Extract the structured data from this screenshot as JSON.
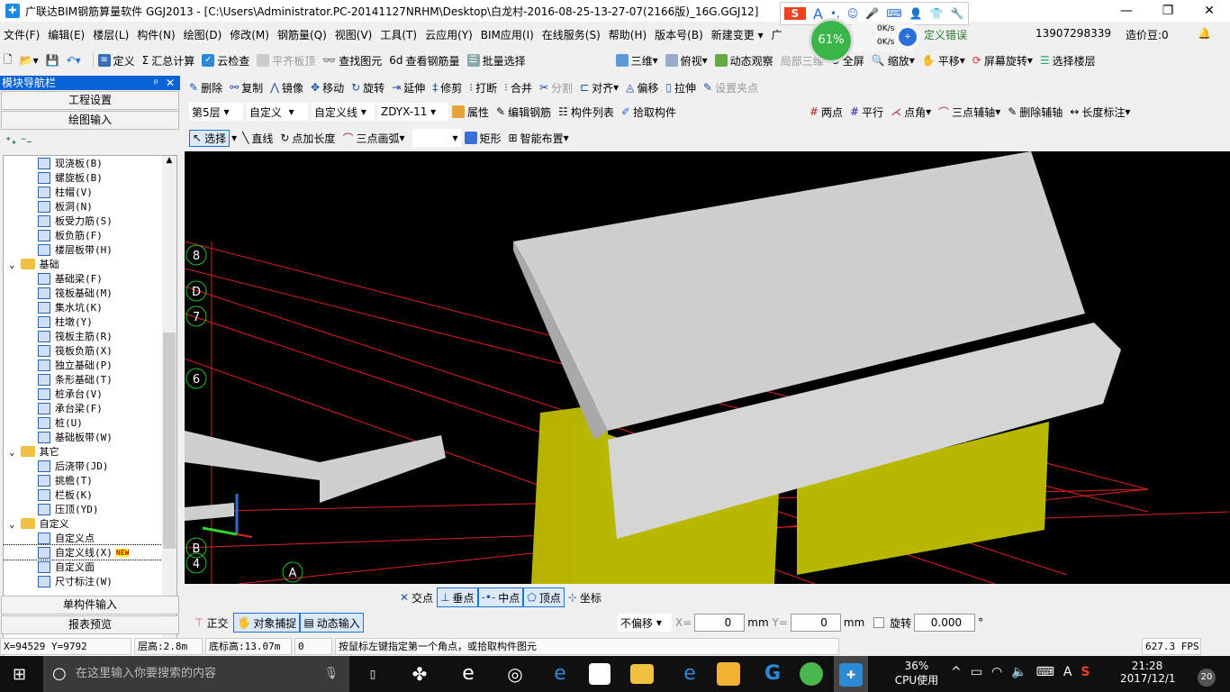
{
  "title": "广联达BIM钢筋算量软件 GGJ2013 - [C:\\Users\\Administrator.PC-20141127NRHM\\Desktop\\白龙村-2016-08-25-13-27-07(2166版)_16G.GGJ12]",
  "menu": [
    "文件(F)",
    "编辑(E)",
    "楼层(L)",
    "构件(N)",
    "绘图(D)",
    "修改(M)",
    "钢筋量(Q)",
    "视图(V)",
    "工具(T)",
    "云应用(Y)",
    "BIM应用(I)",
    "在线服务(S)",
    "帮助(H)",
    "版本号(B)",
    "新建变更 ▾",
    "广",
    "定义错误"
  ],
  "user": {
    "phone": "13907298339",
    "beans": "造价豆:0"
  },
  "net": {
    "percent": "61%",
    "up": "0K/s",
    "down": "0K/s"
  },
  "toolbar1": [
    "定义",
    "汇总计算",
    "云检查",
    "平齐板顶",
    "查找图元",
    "查看钢筋量",
    "批量选择",
    "三维",
    "俯视",
    "动态观察",
    "局部三维",
    "全屏",
    "缩放",
    "平移",
    "屏幕旋转",
    "选择楼层"
  ],
  "toolbar2": [
    "删除",
    "复制",
    "镜像",
    "移动",
    "旋转",
    "延伸",
    "修剪",
    "打断",
    "合并",
    "分割",
    "对齐",
    "偏移",
    "拉伸",
    "设置夹点"
  ],
  "toolbar3": {
    "floor": "第5层",
    "type": "自定义",
    "subtype": "自定义线",
    "component": "ZDYX-11",
    "buttons": [
      "属性",
      "编辑钢筋",
      "构件列表",
      "拾取构件"
    ],
    "axis": [
      "两点",
      "平行",
      "点角",
      "三点辅轴",
      "删除辅轴",
      "长度标注"
    ]
  },
  "toolbar4": [
    "选择",
    "直线",
    "点加长度",
    "三点画弧",
    "矩形",
    "智能布置"
  ],
  "sidebar": {
    "title": "模块导航栏",
    "tabs": [
      "工程设置",
      "绘图输入"
    ],
    "bottom_tabs": [
      "单构件输入",
      "报表预览"
    ],
    "items": [
      {
        "label": "现浇板(B)",
        "level": 2
      },
      {
        "label": "螺旋板(B)",
        "level": 2
      },
      {
        "label": "柱帽(V)",
        "level": 2
      },
      {
        "label": "板洞(N)",
        "level": 2
      },
      {
        "label": "板受力筋(S)",
        "level": 2
      },
      {
        "label": "板负筋(F)",
        "level": 2
      },
      {
        "label": "楼层板带(H)",
        "level": 2
      },
      {
        "label": "基础",
        "level": 1
      },
      {
        "label": "基础梁(F)",
        "level": 2
      },
      {
        "label": "筏板基础(M)",
        "level": 2
      },
      {
        "label": "集水坑(K)",
        "level": 2
      },
      {
        "label": "柱墩(Y)",
        "level": 2
      },
      {
        "label": "筏板主筋(R)",
        "level": 2
      },
      {
        "label": "筏板负筋(X)",
        "level": 2
      },
      {
        "label": "独立基础(P)",
        "level": 2
      },
      {
        "label": "条形基础(T)",
        "level": 2
      },
      {
        "label": "桩承台(V)",
        "level": 2
      },
      {
        "label": "承台梁(F)",
        "level": 2
      },
      {
        "label": "桩(U)",
        "level": 2
      },
      {
        "label": "基础板带(W)",
        "level": 2
      },
      {
        "label": "其它",
        "level": 1
      },
      {
        "label": "后浇带(JD)",
        "level": 2
      },
      {
        "label": "挑檐(T)",
        "level": 2
      },
      {
        "label": "栏板(K)",
        "level": 2
      },
      {
        "label": "压顶(YD)",
        "level": 2
      },
      {
        "label": "自定义",
        "level": 1
      },
      {
        "label": "自定义点",
        "level": 2
      },
      {
        "label": "自定义线(X)",
        "level": 2,
        "badge": "NEW",
        "selected": true
      },
      {
        "label": "自定义面",
        "level": 2
      },
      {
        "label": "尺寸标注(W)",
        "level": 2
      }
    ]
  },
  "grid_labels": [
    "8",
    "D",
    "7",
    "6",
    "B",
    "4",
    "A"
  ],
  "snap": [
    "交点",
    "垂点",
    "中点",
    "顶点",
    "坐标"
  ],
  "snap2": [
    "正交",
    "对象捕捉",
    "动态输入"
  ],
  "offset": {
    "mode": "不偏移",
    "x_label": "X=",
    "x": "0",
    "unit": "mm",
    "y_label": "Y=",
    "y": "0",
    "rotate_label": "旋转",
    "rotate": "0.000",
    "degree": "°"
  },
  "status": {
    "coords": "X=94529 Y=9792",
    "floor_height": "层高:2.8m",
    "base_elev": "底标高:13.07m",
    "zero": "0",
    "hint": "按鼠标左键指定第一个角点，或拾取构件图元",
    "fps": "627.3 FPS"
  },
  "taskbar": {
    "search": "在这里输入你要搜索的内容",
    "cpu": "36%",
    "cpu_label": "CPU使用",
    "time": "21:28",
    "date": "2017/12/1",
    "ime": "A",
    "notif": "20"
  }
}
